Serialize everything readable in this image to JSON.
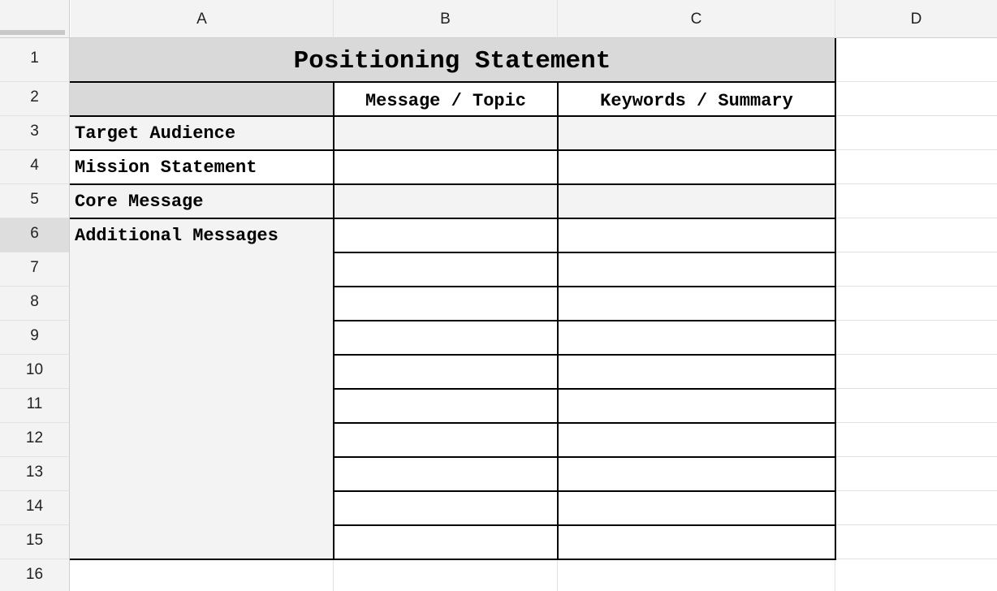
{
  "columns": [
    "A",
    "B",
    "C",
    "D"
  ],
  "rows": [
    "1",
    "2",
    "3",
    "4",
    "5",
    "6",
    "7",
    "8",
    "9",
    "10",
    "11",
    "12",
    "13",
    "14",
    "15",
    "16"
  ],
  "sheet": {
    "title": "Positioning Statement",
    "header_b": "Message / Topic",
    "header_c": "Keywords / Summary",
    "labels": [
      "Target Audience",
      "Mission Statement",
      "Core Message",
      "Additional Messages"
    ]
  },
  "colors": {
    "header_bg": "#f3f3f3",
    "title_bg": "#d9d9d9",
    "shaded_cell": "#f3f3f3",
    "border": "#000000",
    "gridline": "#e2e2e2"
  }
}
